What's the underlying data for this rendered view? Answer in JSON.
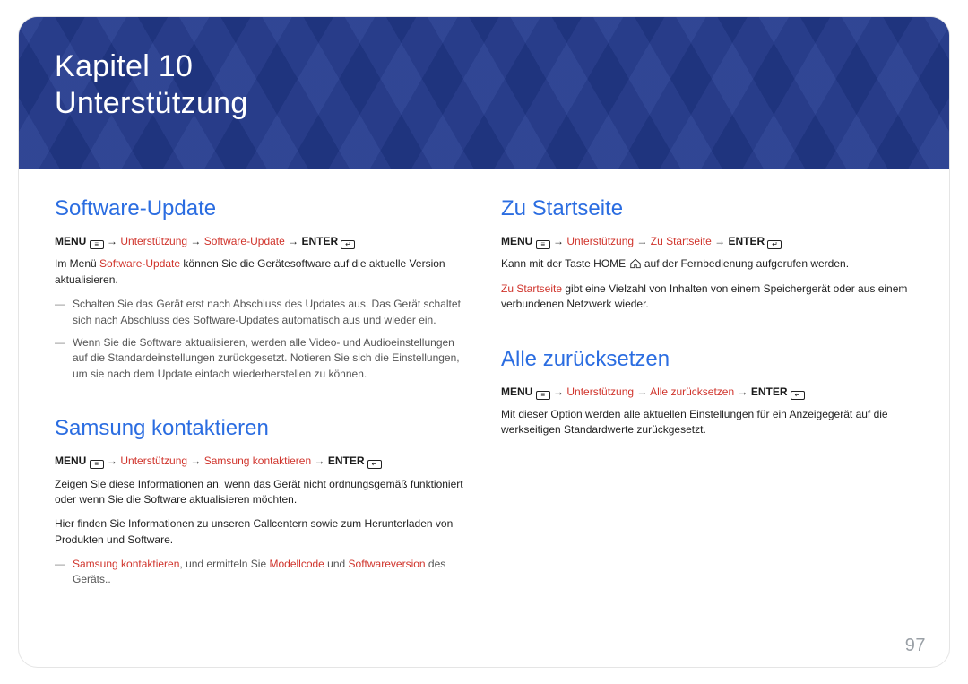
{
  "page_number": "97",
  "hero": {
    "chapter": "Kapitel 10",
    "title": "Unterstützung"
  },
  "left": {
    "software_update": {
      "heading": "Software-Update",
      "menu_prefix": "MENU",
      "menu_path_support": "Unterstützung",
      "menu_path_item": "Software-Update",
      "menu_enter": "ENTER",
      "intro_pre": "Im Menü ",
      "intro_red": "Software-Update",
      "intro_post": " können Sie die Gerätesoftware auf die aktuelle Version aktualisieren.",
      "note1": "Schalten Sie das Gerät erst nach Abschluss des Updates aus. Das Gerät schaltet sich nach Abschluss des Software-Updates automatisch aus und wieder ein.",
      "note2": "Wenn Sie die Software aktualisieren, werden alle Video- und Audioeinstellungen auf die Standardeinstellungen zurückgesetzt. Notieren Sie sich die Einstellungen, um sie nach dem Update einfach wiederherstellen zu können."
    },
    "contact": {
      "heading": "Samsung kontaktieren",
      "menu_prefix": "MENU",
      "menu_path_support": "Unterstützung",
      "menu_path_item": "Samsung kontaktieren",
      "menu_enter": "ENTER",
      "p1": "Zeigen Sie diese Informationen an, wenn das Gerät nicht ordnungsgemäß funktioniert oder wenn Sie die Software aktualisieren möchten.",
      "p2": "Hier finden Sie Informationen zu unseren Callcentern sowie zum Herunterladen von Produkten und Software.",
      "note_red1": "Samsung kontaktieren",
      "note_mid1": ", und ermitteln Sie ",
      "note_red2": "Modellcode",
      "note_mid2": " und ",
      "note_red3": "Softwareversion",
      "note_tail": " des Geräts.."
    }
  },
  "right": {
    "home": {
      "heading": "Zu Startseite",
      "menu_prefix": "MENU",
      "menu_path_support": "Unterstützung",
      "menu_path_item": "Zu Startseite",
      "menu_enter": "ENTER",
      "p1_pre": "Kann mit der Taste ",
      "p1_home": "HOME",
      "p1_post": " auf der Fernbedienung aufgerufen werden.",
      "p2_red": "Zu Startseite",
      "p2_post": " gibt eine Vielzahl von Inhalten von einem Speichergerät oder aus einem verbundenen Netzwerk wieder."
    },
    "reset": {
      "heading": "Alle zurücksetzen",
      "menu_prefix": "MENU",
      "menu_path_support": "Unterstützung",
      "menu_path_item": "Alle zurücksetzen",
      "menu_enter": "ENTER",
      "p1": "Mit dieser Option werden alle aktuellen Einstellungen für ein Anzeigegerät auf die werkseitigen Standardwerte zurückgesetzt."
    }
  }
}
